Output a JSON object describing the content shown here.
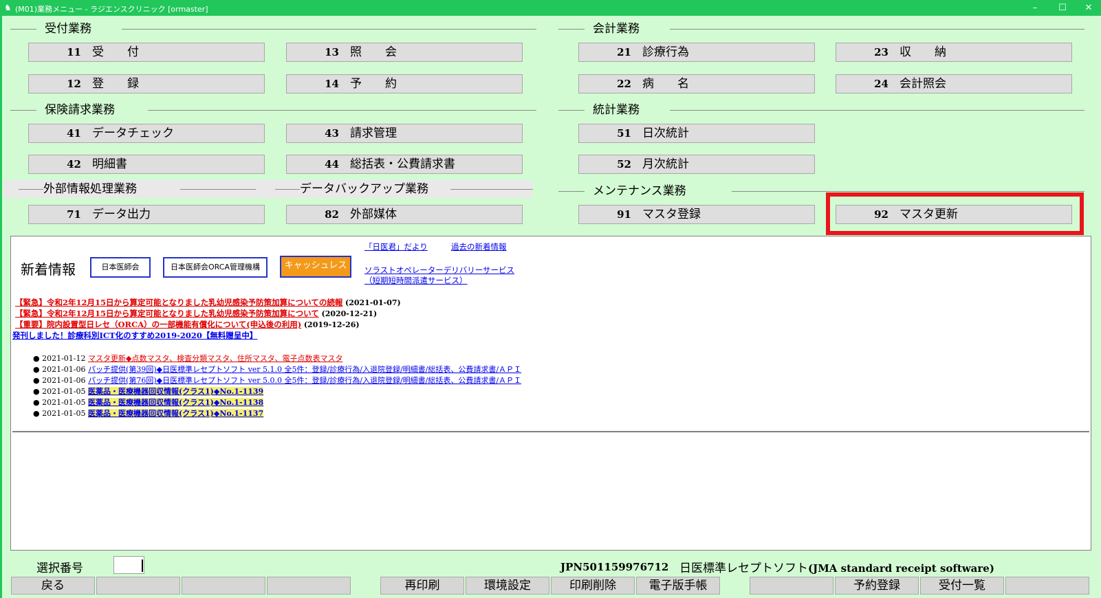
{
  "window": {
    "title": "(M01)業務メニュー - ラジエンスクリニック [ormaster]",
    "minimize": "–",
    "maximize": "☐",
    "close": "✕"
  },
  "sections": {
    "uketsuke": "受付業務",
    "kaikei": "会計業務",
    "hoken": "保険請求業務",
    "toukei": "統計業務",
    "gaibu": "外部情報処理業務",
    "backup": "データバックアップ業務",
    "maintenance": "メンテナンス業務"
  },
  "menu": {
    "b11": {
      "num": "11",
      "label": "受　　付"
    },
    "b13": {
      "num": "13",
      "label": "照　　会"
    },
    "b21": {
      "num": "21",
      "label": "診療行為"
    },
    "b23": {
      "num": "23",
      "label": "収　　納"
    },
    "b12": {
      "num": "12",
      "label": "登　　録"
    },
    "b14": {
      "num": "14",
      "label": "予　　約"
    },
    "b22": {
      "num": "22",
      "label": "病　　名"
    },
    "b24": {
      "num": "24",
      "label": "会計照会"
    },
    "b41": {
      "num": "41",
      "label": "データチェック"
    },
    "b43": {
      "num": "43",
      "label": "請求管理"
    },
    "b51": {
      "num": "51",
      "label": "日次統計"
    },
    "b42": {
      "num": "42",
      "label": "明細書"
    },
    "b44": {
      "num": "44",
      "label": "総括表・公費請求書"
    },
    "b52": {
      "num": "52",
      "label": "月次統計"
    },
    "b71": {
      "num": "71",
      "label": "データ出力"
    },
    "b82": {
      "num": "82",
      "label": "外部媒体"
    },
    "b91": {
      "num": "91",
      "label": "マスタ登録"
    },
    "b92": {
      "num": "92",
      "label": "マスタ更新"
    }
  },
  "news": {
    "heading": "新着情報",
    "logos": {
      "jma": "日本医師会",
      "orca": "日本医師会ORCA管理機構",
      "cashless": "キャッシュレス"
    },
    "links": {
      "nichii": "「日医君」だより",
      "past": "過去の新着情報",
      "solasto1": "ソラストオペレーターデリバリーサービス",
      "solasto2": "（短期短時間派遣サービス）"
    },
    "headlines": [
      {
        "text": "【緊急】令和2年12月15日から算定可能となりました乳幼児感染予防策加算についての続報",
        "date": "(2021-01-07)"
      },
      {
        "text": "【緊急】令和2年12月15日から算定可能となりました乳幼児感染予防策加算について",
        "date": "(2020-12-21)"
      },
      {
        "text": "【重要】院内設置型日レセ（ORCA）の一部機能有償化について(申込後の利用)",
        "date": "(2019-12-26)"
      },
      {
        "text": "発刊しました！診療科別ICT化のすすめ2019-2020【無料贈呈中】",
        "date": ""
      }
    ],
    "items": [
      {
        "date": "● 2021-01-12",
        "text": "マスタ更新◆点数マスタ、検査分類マスタ、住所マスタ、電子点数表マスタ"
      },
      {
        "date": "● 2021-01-06",
        "text": "パッチ提供(第39回)◆日医標準レセプトソフト ver 5.1.0 全5件：登録/診療行為/入退院登録/明細書/総括表、公費請求書/ＡＰＩ"
      },
      {
        "date": "● 2021-01-06",
        "text": "パッチ提供(第76回)◆日医標準レセプトソフト ver 5.0.0 全5件：登録/診療行為/入退院登録/明細書/総括表、公費請求書/ＡＰＩ"
      },
      {
        "date": "● 2021-01-05",
        "text": "医薬品・医療機器回収情報(クラス1)◆No.1-1139"
      },
      {
        "date": "● 2021-01-05",
        "text": "医薬品・医療機器回収情報(クラス1)◆No.1-1138"
      },
      {
        "date": "● 2021-01-05",
        "text": "医薬品・医療機器回収情報(クラス1)◆No.1-1137"
      }
    ]
  },
  "status": {
    "select_label": "選択番号",
    "select_value": "",
    "jpn": "JPN501159976712",
    "software_jp": "日医標準レセプトソフト",
    "software_en": "(JMA standard receipt software)"
  },
  "footer": {
    "f1": "戻る",
    "f2": "",
    "f3": "",
    "f4": "",
    "f5": "再印刷",
    "f6": "環境設定",
    "f7": "印刷削除",
    "f8": "電子版手帳",
    "f9": "",
    "f10": "予約登録",
    "f11": "受付一覧",
    "f12": ""
  },
  "colors": {
    "title_bar": "#21c75a",
    "background": "#d3fbd3",
    "highlight": "#e8161b",
    "link": "#0000ee",
    "urgent": "#e00000",
    "cashless": "#f39a1a"
  }
}
